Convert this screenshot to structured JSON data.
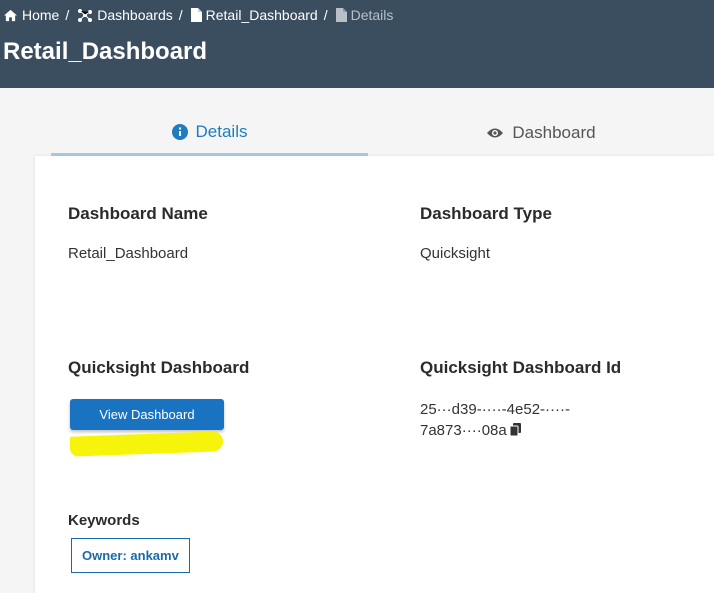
{
  "breadcrumb": {
    "items": [
      {
        "label": "Home",
        "icon": "home-icon"
      },
      {
        "label": "Dashboards",
        "icon": "dashboards-icon"
      },
      {
        "label": "Retail_Dashboard",
        "icon": "file-icon"
      },
      {
        "label": "Details",
        "icon": "file-icon"
      }
    ],
    "separator": "/"
  },
  "page": {
    "title": "Retail_Dashboard"
  },
  "tabs": [
    {
      "label": "Details",
      "icon": "info-icon",
      "active": true
    },
    {
      "label": "Dashboard",
      "icon": "eye-icon",
      "active": false
    }
  ],
  "details": {
    "dashboard_name_label": "Dashboard Name",
    "dashboard_name_value": "Retail_Dashboard",
    "dashboard_type_label": "Dashboard Type",
    "dashboard_type_value": "Quicksight",
    "quicksight_dashboard_label": "Quicksight Dashboard",
    "view_button_label": "View Dashboard",
    "quicksight_id_label": "Quicksight Dashboard Id",
    "quicksight_id_line1": "25···d39-····-4e52-····-",
    "quicksight_id_line2": "7a873····08a"
  },
  "keywords": {
    "label": "Keywords",
    "items": [
      "Owner: ankamv"
    ]
  },
  "colors": {
    "header_bg": "#3b4e5f",
    "accent": "#1a73c1",
    "highlight": "#f7f40c"
  }
}
